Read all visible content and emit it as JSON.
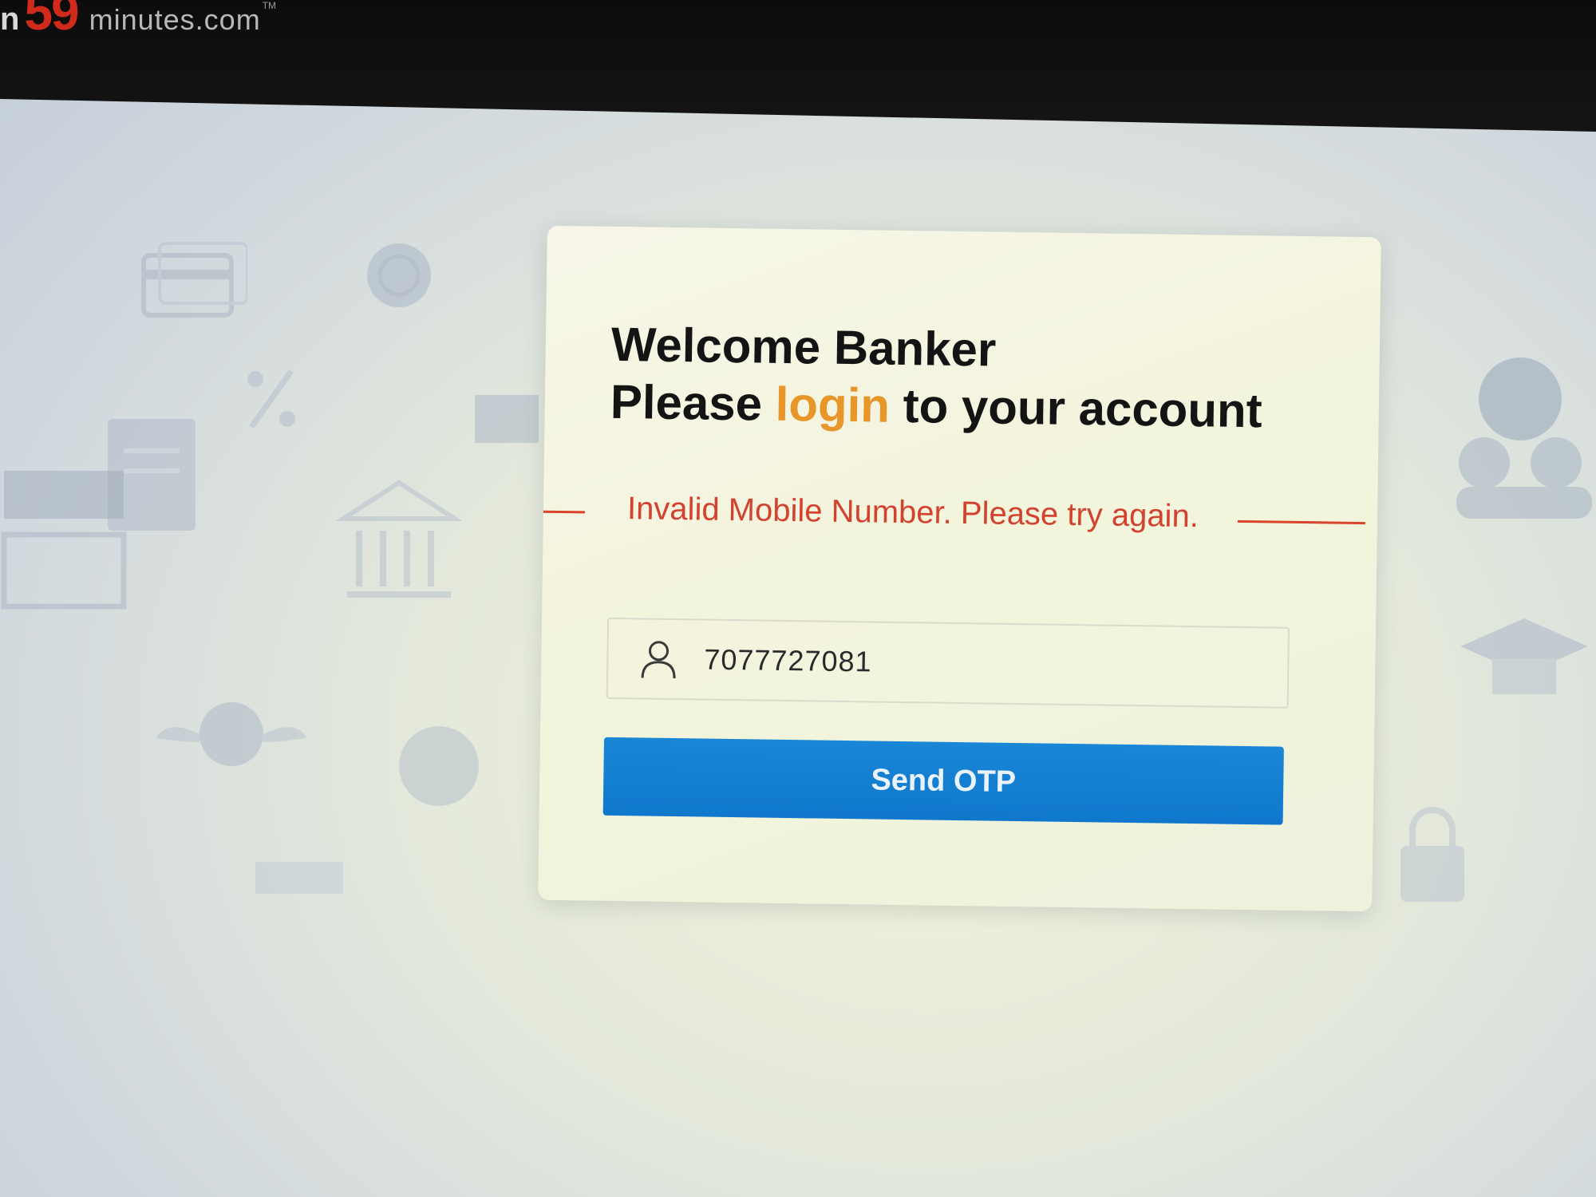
{
  "logo": {
    "prefix": "n",
    "number": "59",
    "domain": "minutes.com",
    "tm": "TM"
  },
  "login": {
    "welcome": "Welcome Banker",
    "line2_before": "Please ",
    "line2_accent": "login",
    "line2_after": " to your account",
    "error_message": "Invalid Mobile Number. Please try again.",
    "mobile_value": "7077727081",
    "send_otp_label": "Send OTP"
  },
  "colors": {
    "accent_orange": "#e8962a",
    "error_red": "#d2422e",
    "button_blue": "#1a86d6"
  },
  "icons": {
    "field": "user-icon",
    "background": [
      "credit-card-icon",
      "coin-icon",
      "percent-icon",
      "document-icon",
      "bank-icon",
      "storefront-icon",
      "wings-icon",
      "piggy-bank-icon",
      "people-icon",
      "graduation-cap-icon",
      "lock-icon"
    ]
  }
}
